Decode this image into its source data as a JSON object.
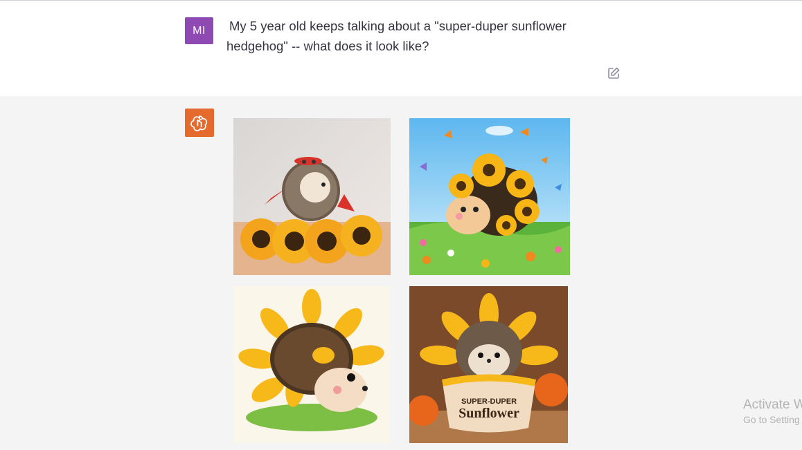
{
  "user_message": {
    "avatar_initials": "MI",
    "text": "My 5 year old keeps talking about a \"super-duper sunflower hedgehog\" -- what does it look like?",
    "edit_icon": "pencil-square-icon"
  },
  "assistant": {
    "avatar_icon": "openai-logo-icon",
    "images": [
      {
        "description": "hedgehog-red-mask-sunflowers"
      },
      {
        "description": "cartoon-hedgehog-sunflower-meadow-butterflies"
      },
      {
        "description": "watercolor-hedgehog-sunflower-petals"
      },
      {
        "description": "hedgehog-in-sunflower-pot"
      }
    ],
    "pot_text": {
      "line1": "SUPER-DUPER",
      "line2": "Sunflower"
    }
  },
  "watermark": {
    "title": "Activate W",
    "subtitle": "Go to Setting"
  },
  "colors": {
    "user_avatar": "#8e4ab2",
    "bot_avatar": "#e46a2e",
    "text": "#343541",
    "assistant_bg": "#f4f4f4"
  }
}
